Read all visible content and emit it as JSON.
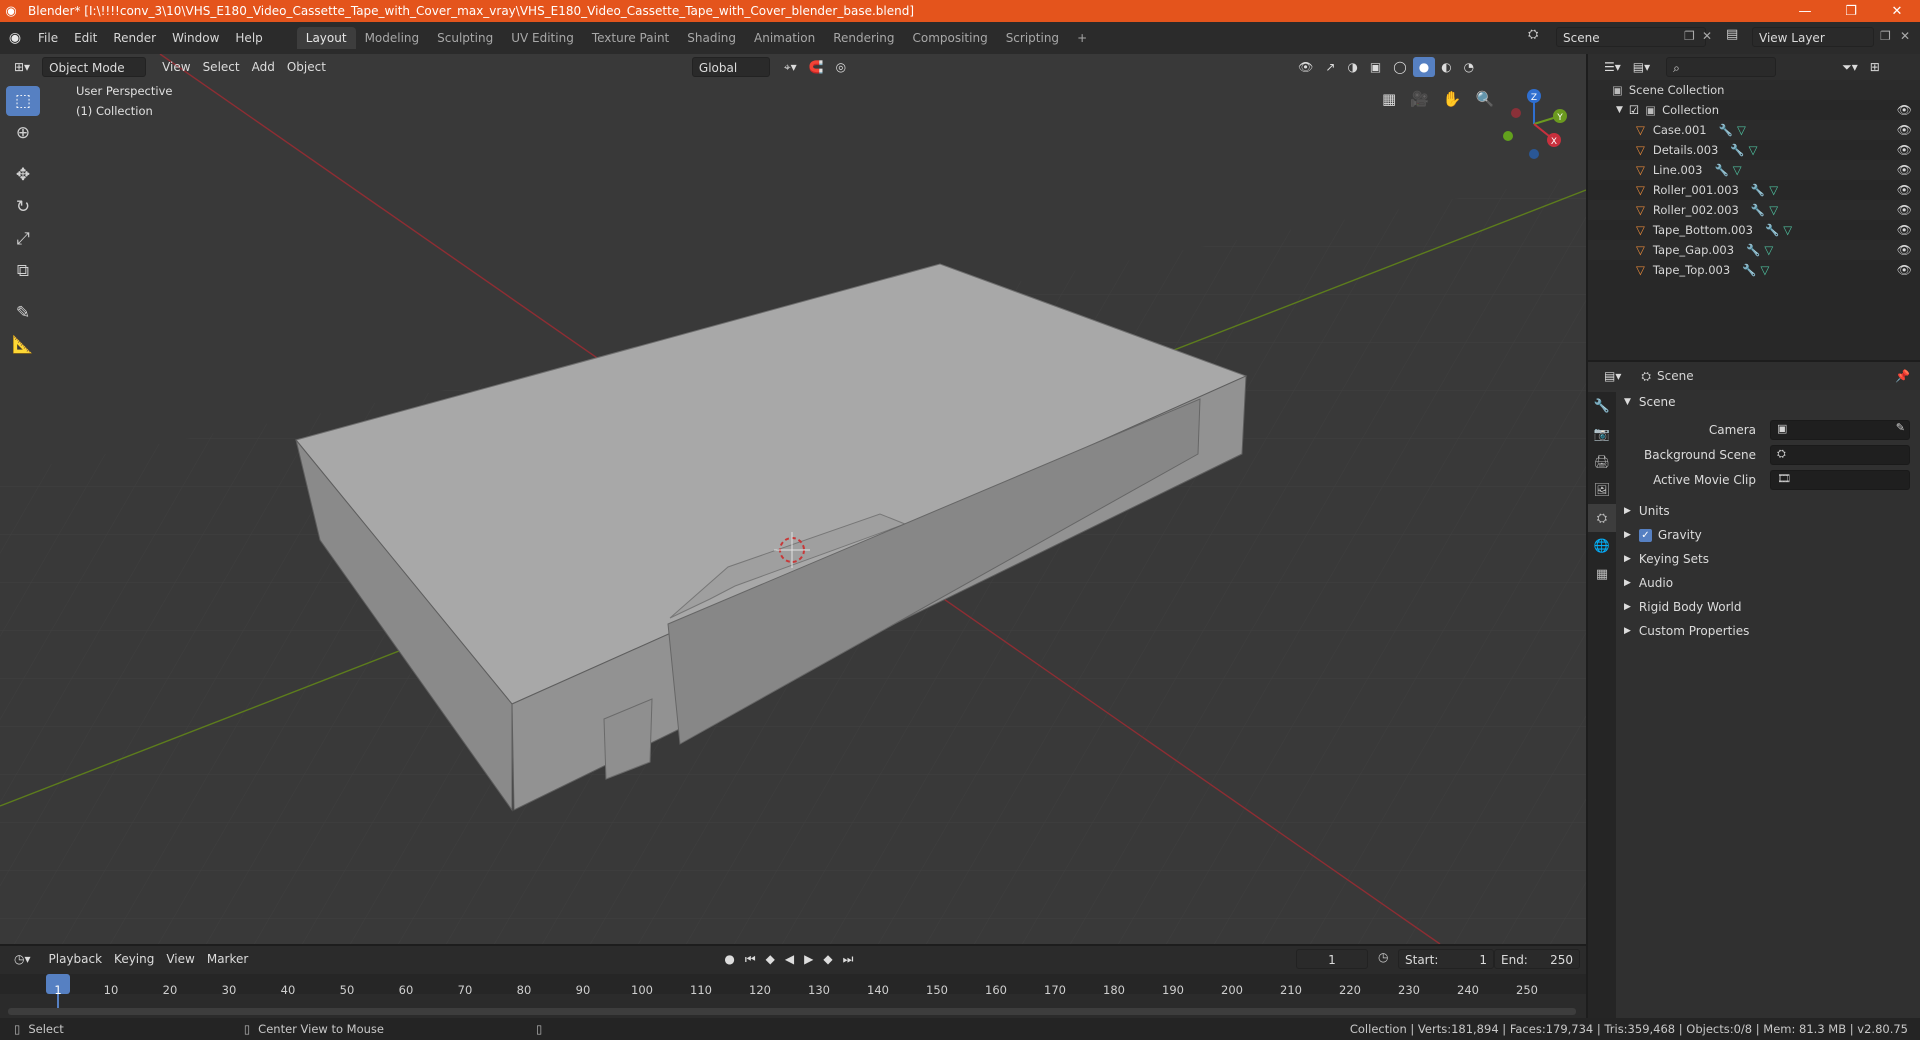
{
  "titlebar": {
    "title": "Blender* [I:\\!!!!conv_3\\10\\VHS_E180_Video_Cassette_Tape_with_Cover_max_vray\\VHS_E180_Video_Cassette_Tape_with_Cover_blender_base.blend]",
    "minimize": "—",
    "maximize": "❐",
    "close": "✕"
  },
  "menu": {
    "items": [
      "File",
      "Edit",
      "Render",
      "Window",
      "Help"
    ],
    "workspaces": [
      "Layout",
      "Modeling",
      "Sculpting",
      "UV Editing",
      "Texture Paint",
      "Shading",
      "Animation",
      "Rendering",
      "Compositing",
      "Scripting"
    ],
    "active_workspace": "Layout",
    "add_tab": "+",
    "scene_label": "Scene",
    "view_layer_label": "View Layer"
  },
  "viewport": {
    "mode": "Object Mode",
    "menus": [
      "View",
      "Select",
      "Add",
      "Object"
    ],
    "orientation": "Global",
    "overlay_title": "User Perspective",
    "overlay_collection": "(1) Collection",
    "gizmo": {
      "z": "Z",
      "y": "Y",
      "x": "X"
    }
  },
  "outliner": {
    "root": "Scene Collection",
    "collection": "Collection",
    "objects": [
      "Case.001",
      "Details.003",
      "Line.003",
      "Roller_001.003",
      "Roller_002.003",
      "Tape_Bottom.003",
      "Tape_Gap.003",
      "Tape_Top.003"
    ]
  },
  "properties": {
    "header": "Scene",
    "section": "Scene",
    "fields": [
      {
        "label": "Camera"
      },
      {
        "label": "Background Scene"
      },
      {
        "label": "Active Movie Clip"
      }
    ],
    "panels": [
      "Units",
      "Gravity",
      "Keying Sets",
      "Audio",
      "Rigid Body World",
      "Custom Properties"
    ],
    "gravity_checked": true
  },
  "timeline": {
    "menus": [
      "Playback",
      "Keying",
      "View",
      "Marker"
    ],
    "current_frame": "1",
    "start_label": "Start:",
    "start": "1",
    "end_label": "End:",
    "end": "250",
    "ruler": [
      "1",
      "10",
      "20",
      "30",
      "40",
      "50",
      "60",
      "70",
      "80",
      "90",
      "100",
      "110",
      "120",
      "130",
      "140",
      "150",
      "160",
      "170",
      "180",
      "190",
      "200",
      "210",
      "220",
      "230",
      "240",
      "250"
    ]
  },
  "statusbar": {
    "select": "Select",
    "center_view": "Center View to Mouse",
    "stats": "Collection | Verts:181,894 | Faces:179,734 | Tris:359,468 | Objects:0/8 | Mem: 81.3 MB | v2.80.75"
  },
  "colors": {
    "titlebar": "#e4541c",
    "accent": "#5680c2",
    "x_axis": "#c8303d",
    "y_axis": "#6b9a1f",
    "z_axis": "#2f6fd0"
  }
}
